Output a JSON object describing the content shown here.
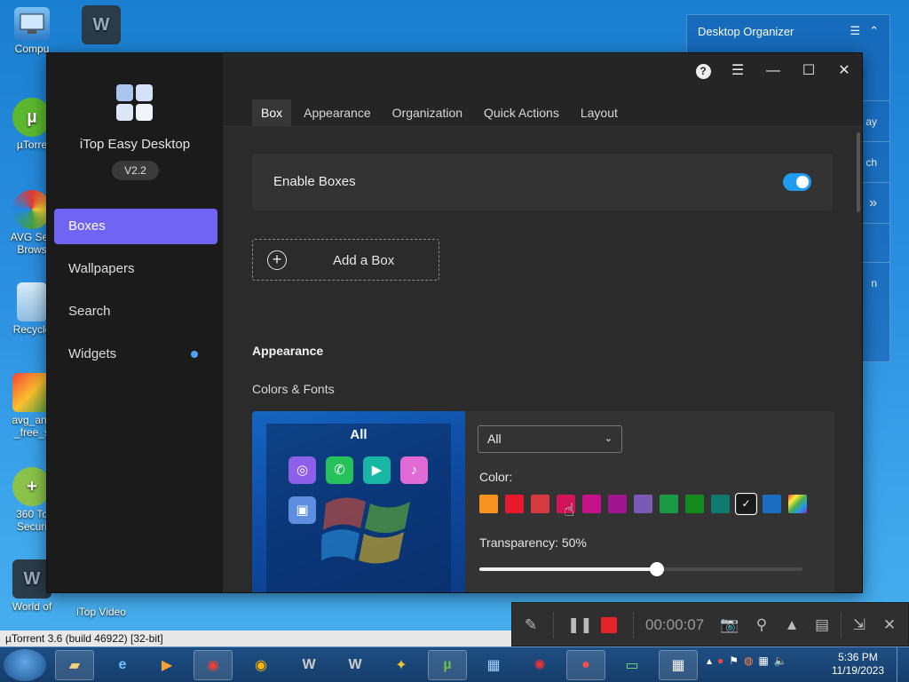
{
  "desktop": {
    "icons": [
      {
        "label": "Compu",
        "icon": "computer-icon"
      },
      {
        "label": "µTorre",
        "icon": "utorrent-icon"
      },
      {
        "label": "AVG Sec\nBrows",
        "icon": "avg-browser-icon"
      },
      {
        "label": "Recycle",
        "icon": "recycle-bin-icon"
      },
      {
        "label": "avg_anti\n_free_s",
        "icon": "avg-installer-icon"
      },
      {
        "label": "360 To\nSecuri",
        "icon": "360-security-icon"
      },
      {
        "label": "World of",
        "icon": "world-of-tanks-icon"
      },
      {
        "label": "iTop Video",
        "icon": "itop-video-icon"
      }
    ]
  },
  "organizer": {
    "title": "Desktop Organizer",
    "rows": [
      "ay",
      "ch",
      "»",
      "",
      "n"
    ]
  },
  "app": {
    "name": "iTop Easy Desktop",
    "version": "V2.2",
    "nav": [
      "Boxes",
      "Wallpapers",
      "Search",
      "Widgets"
    ],
    "tabs": [
      "Box",
      "Appearance",
      "Organization",
      "Quick Actions",
      "Layout"
    ],
    "enable_boxes_label": "Enable Boxes",
    "add_box_label": "Add a Box",
    "appearance_title": "Appearance",
    "colors_fonts_label": "Colors & Fonts",
    "preview_title": "All",
    "select_value": "All",
    "color_label": "Color:",
    "transparency_label": "Transparency: 50%",
    "transparency_value": 0.55,
    "swatches": [
      "#f7931e",
      "#e8192c",
      "#d43a3f",
      "#d4145a",
      "#c4128b",
      "#a0148f",
      "#7a5ab5",
      "#1a9a45",
      "#138a1e",
      "#0f7a6e",
      "#1a1a1a",
      "#1a6fc4",
      "rainbow"
    ],
    "enable_boxes_on": true
  },
  "statusbar": {
    "text": "µTorrent 3.6  (build 46922) [32-bit]"
  },
  "recorder": {
    "time": "00:00:07"
  },
  "taskbar": {
    "clock_time": "5:36 PM",
    "clock_date": "11/19/2023"
  }
}
